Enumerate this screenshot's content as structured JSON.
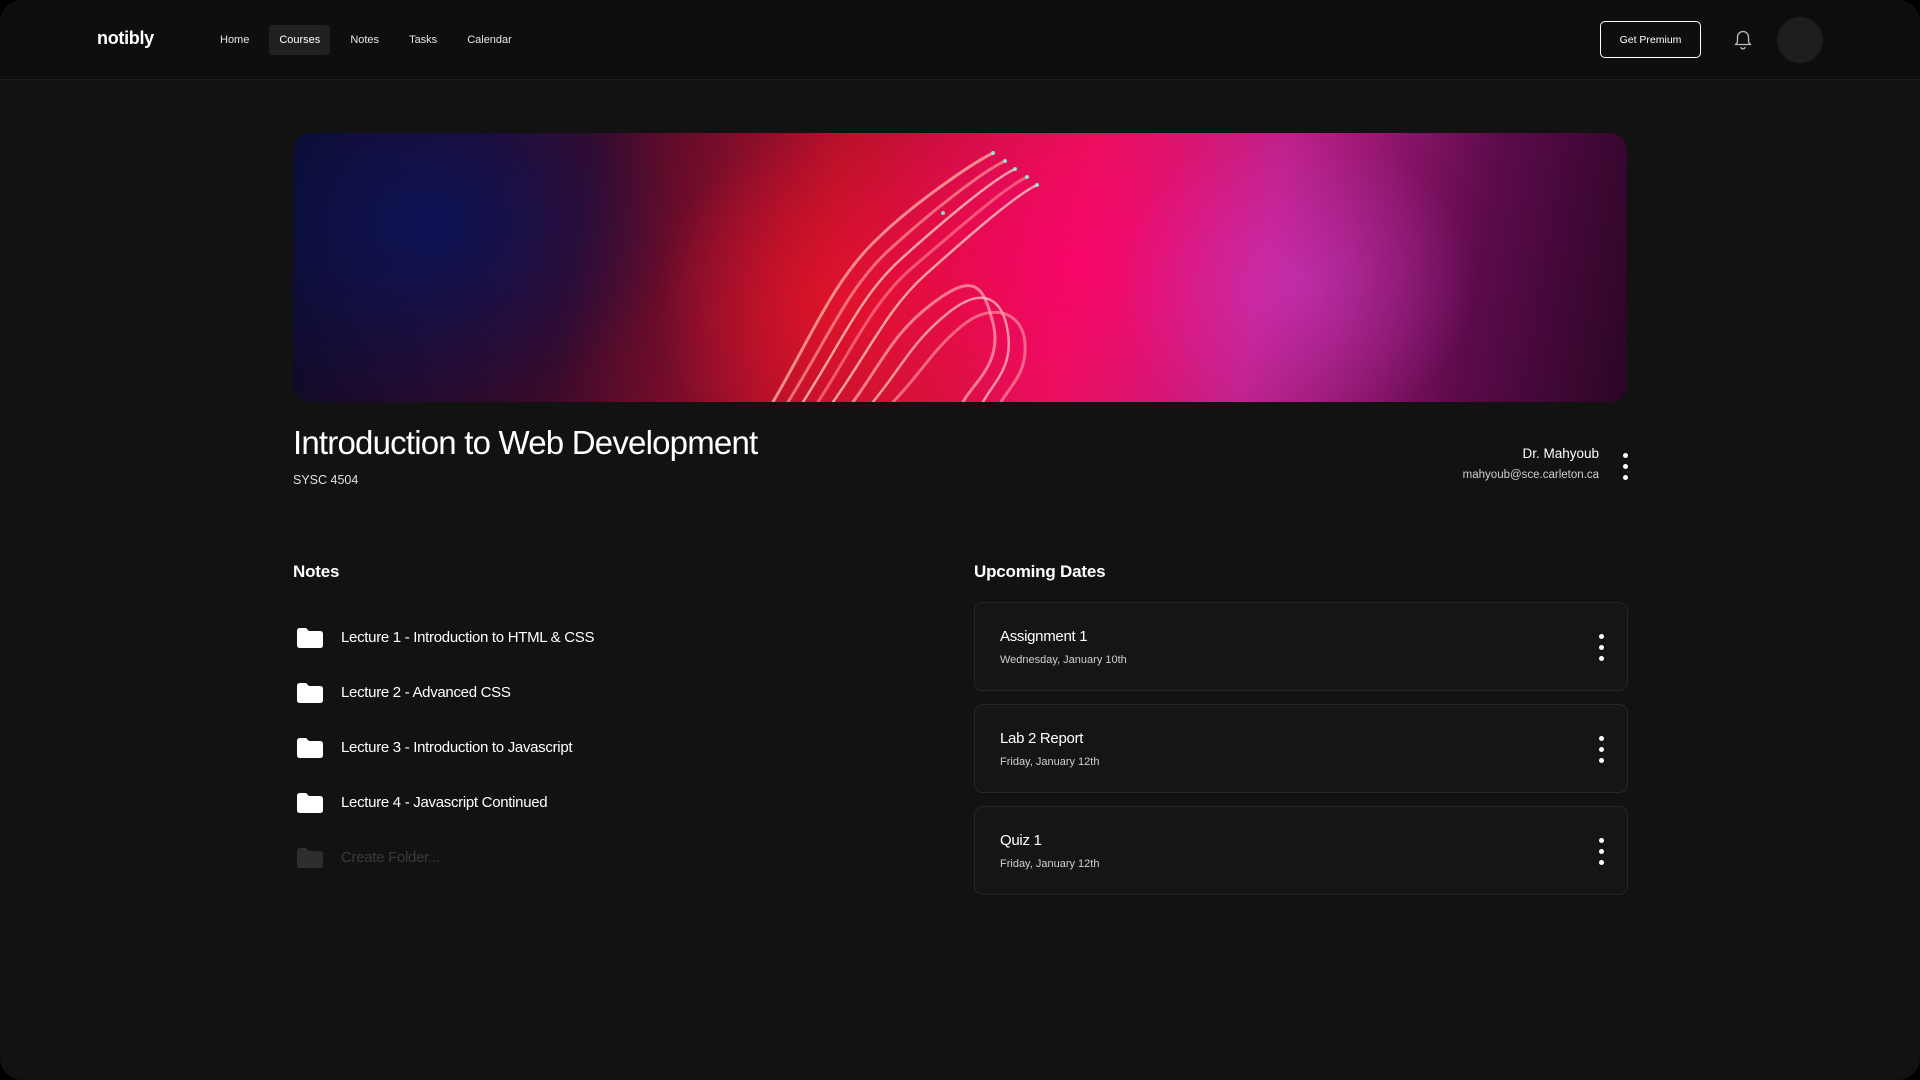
{
  "header": {
    "logo": "notibly",
    "nav": [
      {
        "label": "Home",
        "active": false
      },
      {
        "label": "Courses",
        "active": true
      },
      {
        "label": "Notes",
        "active": false
      },
      {
        "label": "Tasks",
        "active": false
      },
      {
        "label": "Calendar",
        "active": false
      }
    ],
    "premium_label": "Get Premium",
    "icons": {
      "notifications": "bell-icon",
      "profile": "avatar"
    }
  },
  "course": {
    "title": "Introduction to Web Development",
    "code": "SYSC 4504",
    "instructor": {
      "name": "Dr. Mahyoub",
      "email": "mahyoub@sce.carleton.ca"
    }
  },
  "notes": {
    "title": "Notes",
    "folders": [
      {
        "label": "Lecture 1 - Introduction to HTML & CSS"
      },
      {
        "label": "Lecture 2 - Advanced CSS"
      },
      {
        "label": "Lecture 3 - Introduction to Javascript"
      },
      {
        "label": "Lecture 4 - Javascript Continued"
      }
    ],
    "create_placeholder": "Create Folder..."
  },
  "upcoming": {
    "title": "Upcoming Dates",
    "items": [
      {
        "name": "Assignment 1",
        "date": "Wednesday, January 10th"
      },
      {
        "name": "Lab 2 Report",
        "date": "Friday, January 12th"
      },
      {
        "name": "Quiz 1",
        "date": "Friday, January 12th"
      }
    ]
  },
  "colors": {
    "background": "#121212",
    "header": "#0e0e0e",
    "card": "#151515",
    "card_border": "#262626",
    "muted_text": "#3a3a3a"
  }
}
